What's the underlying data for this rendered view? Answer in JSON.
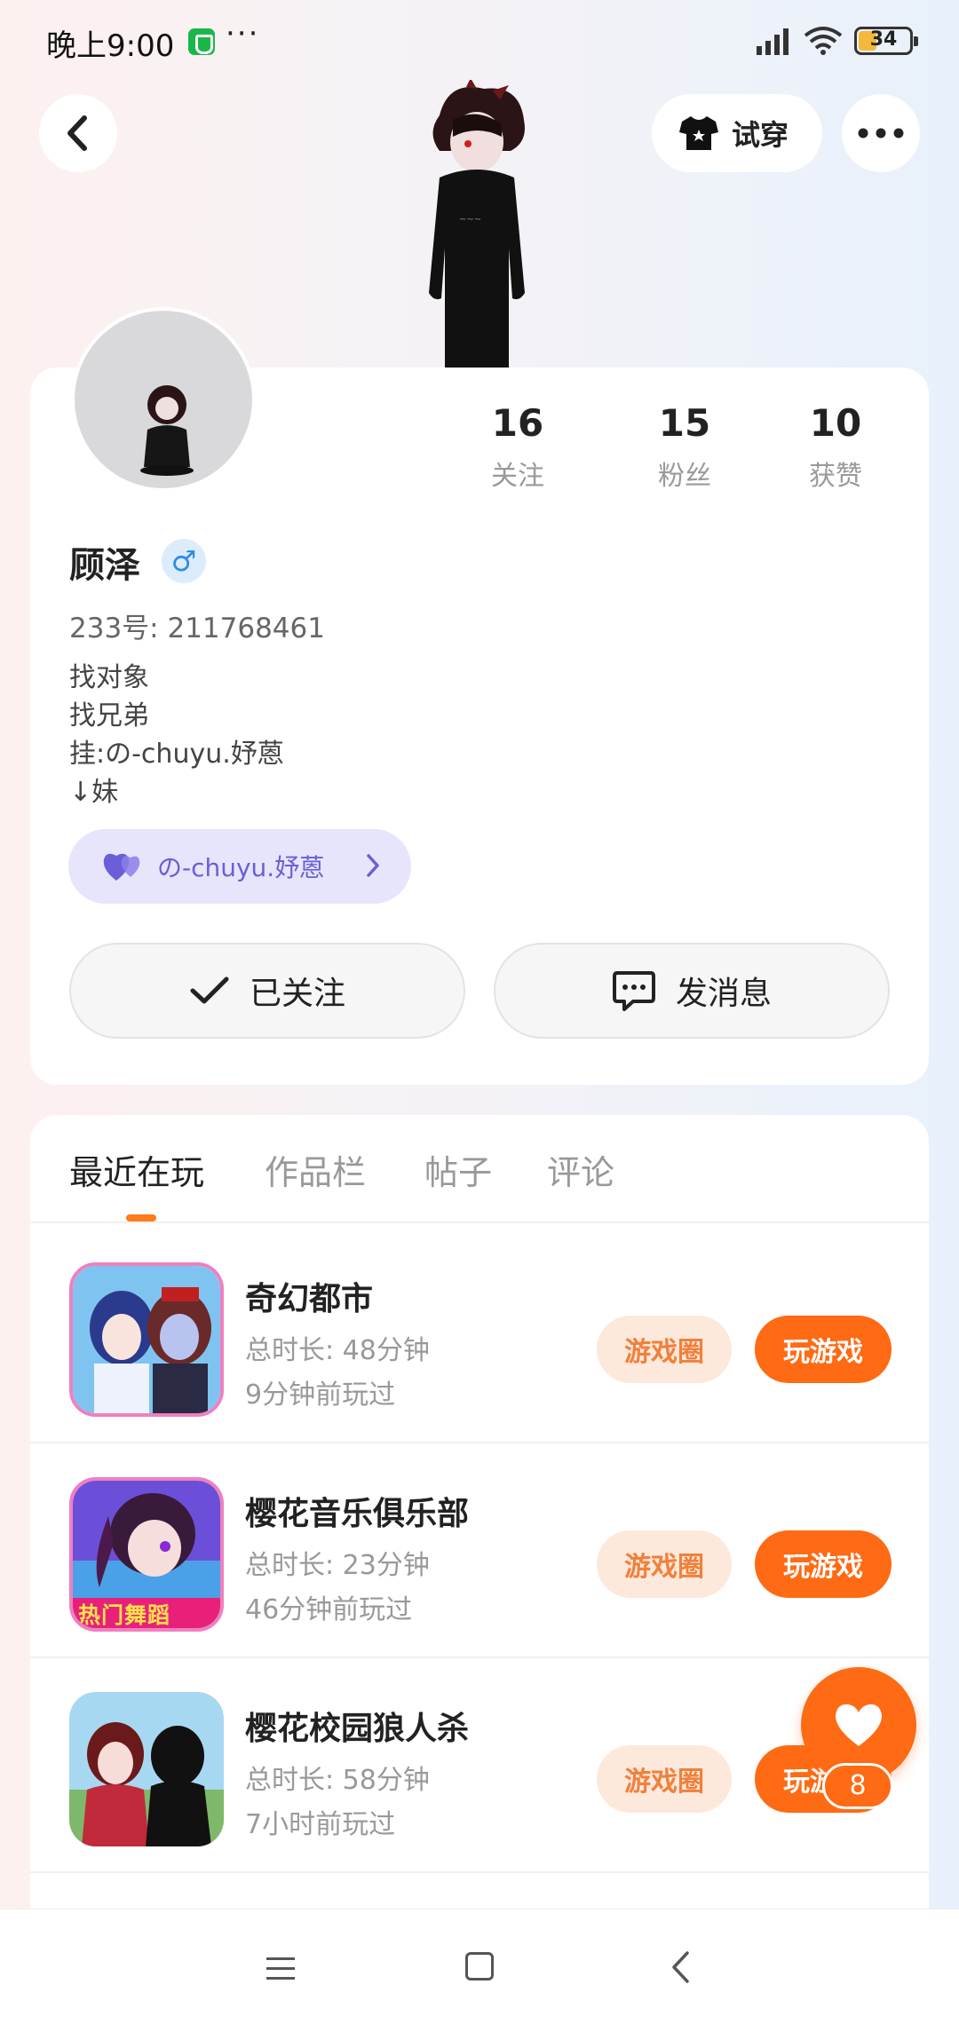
{
  "status_bar": {
    "time": "晚上9:00",
    "dots": "···",
    "battery": "34"
  },
  "header": {
    "try_on_label": "试穿"
  },
  "profile": {
    "stats": [
      {
        "value": "16",
        "label": "关注"
      },
      {
        "value": "15",
        "label": "粉丝"
      },
      {
        "value": "10",
        "label": "获赞"
      }
    ],
    "name": "顾泽",
    "gender_symbol": "♂",
    "id_text": "233号: 211768461",
    "bio": [
      "找对象",
      "找兄弟",
      "挂:の-chuyu.妤蒽",
      "↓妹"
    ],
    "relation_label": "の-chuyu.妤蒽",
    "follow_label": "已关注",
    "message_label": "发消息"
  },
  "tabs": [
    {
      "label": "最近在玩",
      "active": true
    },
    {
      "label": "作品栏",
      "active": false
    },
    {
      "label": "帖子",
      "active": false
    },
    {
      "label": "评论",
      "active": false
    }
  ],
  "games": [
    {
      "title": "奇幻都市",
      "duration": "总时长: 48分钟",
      "last_played": "9分钟前玩过",
      "circle_label": "游戏圈",
      "play_label": "玩游戏"
    },
    {
      "title": "樱花音乐俱乐部",
      "duration": "总时长: 23分钟",
      "last_played": "46分钟前玩过",
      "circle_label": "游戏圈",
      "play_label": "玩游戏",
      "icon_text": "热门舞蹈"
    },
    {
      "title": "樱花校园狼人杀",
      "duration": "总时长: 58分钟",
      "last_played": "7小时前玩过",
      "circle_label": "游戏圈",
      "play_label": "玩游戏"
    }
  ],
  "like_fab": {
    "count": "8"
  },
  "colors": {
    "accent": "#ff6a14",
    "accent_light": "#fde8dc",
    "relation_bg": "#e6e5fb",
    "relation_text": "#6a5fd6"
  }
}
